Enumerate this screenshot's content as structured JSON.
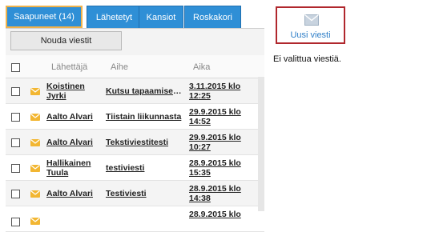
{
  "tabs": [
    {
      "label": "Saapuneet (14)"
    },
    {
      "label": "Lähetetyt"
    },
    {
      "label": "Kansiot"
    },
    {
      "label": "Roskakori"
    }
  ],
  "toolbar": {
    "fetch_label": "Nouda viestit"
  },
  "table": {
    "headers": {
      "sender": "Lähettäjä",
      "subject": "Aihe",
      "time": "Aika"
    },
    "rows": [
      {
        "sender": "Koistinen Jyrki",
        "subject": "Kutsu tapaamiseen…",
        "time": "3.11.2015 klo 12:25"
      },
      {
        "sender": "Aalto Alvari",
        "subject": "Tiistain liikunnasta",
        "time": "29.9.2015 klo 14:52"
      },
      {
        "sender": "Aalto Alvari",
        "subject": "Tekstiviestitesti",
        "time": "29.9.2015 klo 10:27"
      },
      {
        "sender": "Hallikainen Tuula",
        "subject": "testiviesti",
        "time": "28.9.2015 klo 15:35"
      },
      {
        "sender": "Aalto Alvari",
        "subject": "Testiviesti",
        "time": "28.9.2015 klo 14:38"
      },
      {
        "sender": "",
        "subject": "",
        "time": "28.9.2015 klo"
      }
    ]
  },
  "compose": {
    "label": "Uusi viesti",
    "icon": "envelope-icon"
  },
  "preview": {
    "empty_text": "Ei valittua viestiä."
  },
  "colors": {
    "tab_bg": "#2f8fd6",
    "active_border": "#f0b24a",
    "envelope": "#f2b632",
    "compose_border": "#b0272d",
    "link_blue": "#2f7fc8"
  }
}
